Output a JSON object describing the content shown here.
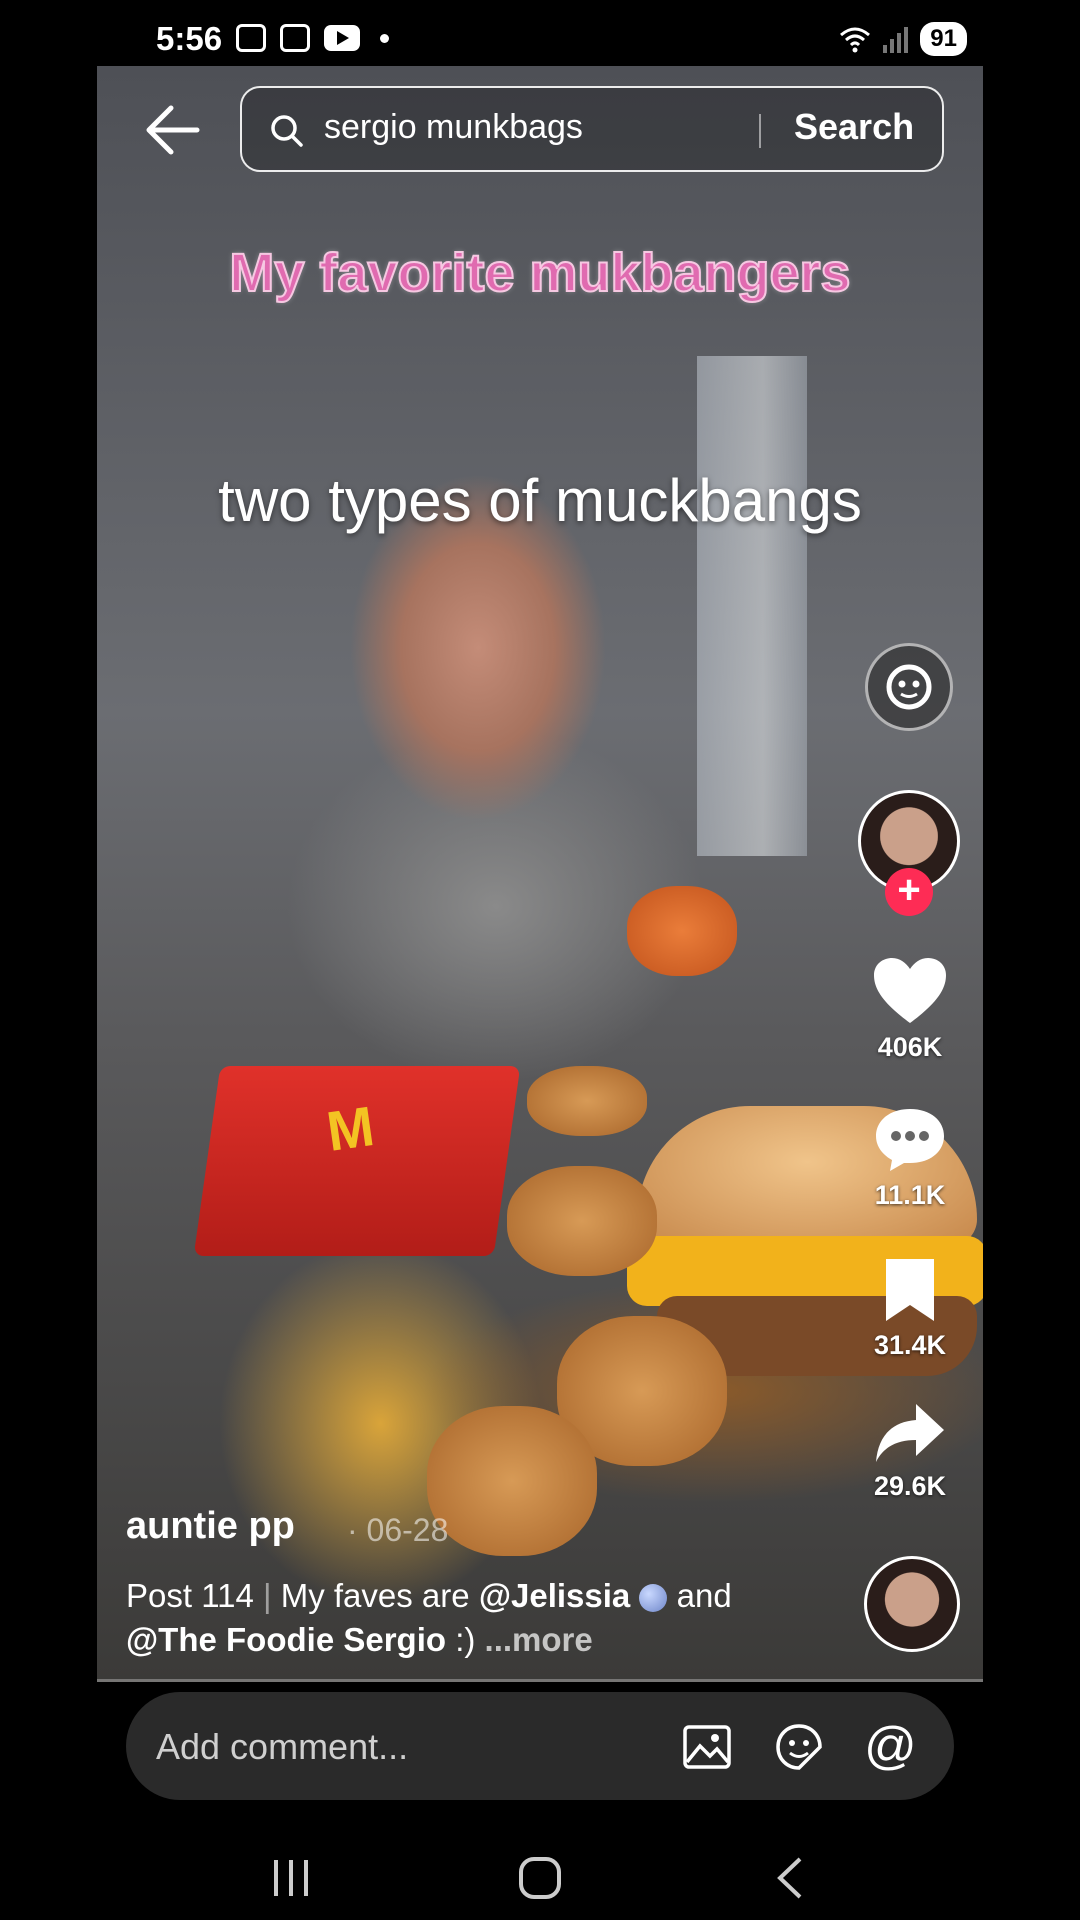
{
  "status_bar": {
    "time": "5:56",
    "battery": "91"
  },
  "search": {
    "query": "sergio munkbags",
    "button_label": "Search"
  },
  "video": {
    "overlay_title": "My favorite mukbangers",
    "overlay_subtitle": "two types of muckbangs",
    "fries_logo": "M"
  },
  "actions": {
    "likes": "406K",
    "comments": "11.1K",
    "saves": "31.4K",
    "shares": "29.6K"
  },
  "post": {
    "author": "auntie pp",
    "date": "· 06-28",
    "post_label": "Post 114",
    "separator": "|",
    "caption_prefix": "My faves are",
    "mention_1": "@Jelissia",
    "caption_mid": "and",
    "mention_2": "@The Foodie Sergio",
    "caption_suffix": ":)",
    "more_label": "...more"
  },
  "comment_bar": {
    "placeholder": "Add comment...",
    "at_label": "@"
  },
  "icons": {
    "back": "back-arrow-icon",
    "search": "search-icon",
    "reaction": "reaction-face-icon",
    "like": "heart-icon",
    "comment": "comment-bubble-icon",
    "save": "bookmark-icon",
    "share": "share-arrow-icon",
    "image": "image-icon",
    "emoji": "emoji-icon"
  },
  "colors": {
    "follow": "#fe2c55",
    "title_pink": "#e06bb0"
  }
}
